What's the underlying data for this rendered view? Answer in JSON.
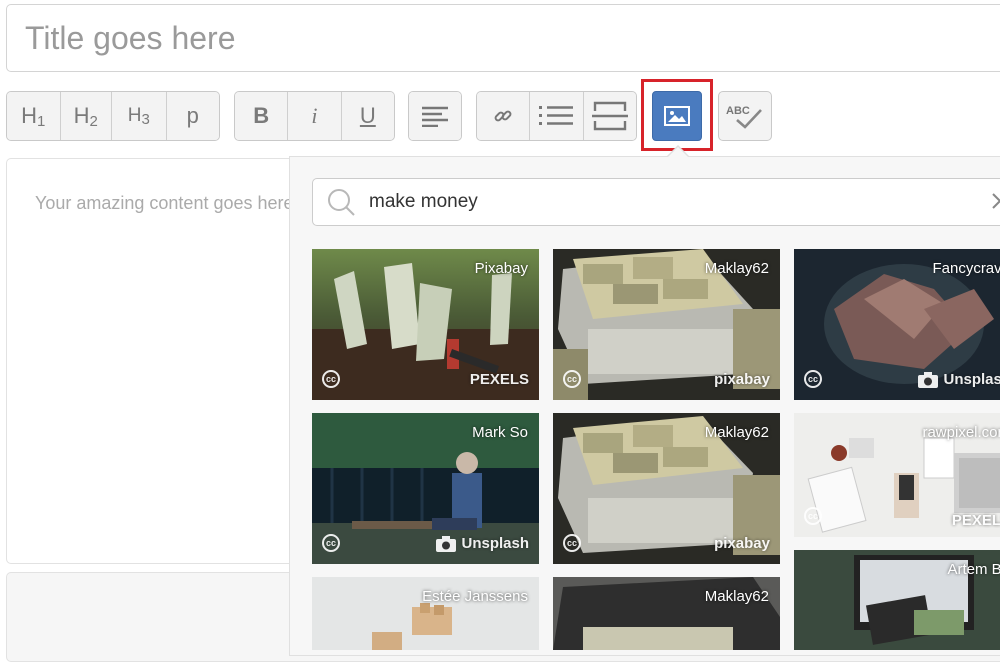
{
  "editor": {
    "title_placeholder": "Title goes here",
    "content_placeholder": "Your amazing content goes here"
  },
  "toolbar": {
    "heading_buttons": [
      {
        "label": "H",
        "sub": "1"
      },
      {
        "label": "H",
        "sub": "2"
      },
      {
        "label": "H",
        "sub": "3"
      },
      {
        "label": "p"
      }
    ],
    "format_buttons": [
      {
        "label": "B"
      },
      {
        "label": "i"
      },
      {
        "label": "U"
      }
    ],
    "spellcheck_label": "ABC",
    "icons": {
      "align": "align-left-icon",
      "link": "link-icon",
      "list": "bullet-list-icon",
      "divider": "horizontal-rule-icon",
      "image": "image-icon",
      "spellcheck": "spellcheck-icon"
    },
    "active_color": "#4a7bbf",
    "highlight_color": "#d7232a"
  },
  "image_search": {
    "query": "make money",
    "results": [
      {
        "credit": "Pixabay",
        "source": "PEXELS"
      },
      {
        "credit": "Maklay62",
        "source": "pixabay"
      },
      {
        "credit": "Fancycrave",
        "source": "Unsplash"
      },
      {
        "credit": "Mark So",
        "source": "Unsplash"
      },
      {
        "credit": "Maklay62",
        "source": "pixabay"
      },
      {
        "credit": "rawpixel.com",
        "source": "PEXELS"
      },
      {
        "credit": "Estée Janssens",
        "source": ""
      },
      {
        "credit": "Maklay62",
        "source": ""
      },
      {
        "credit": "Artem Ba",
        "source": ""
      }
    ],
    "license_badge": "cc"
  }
}
